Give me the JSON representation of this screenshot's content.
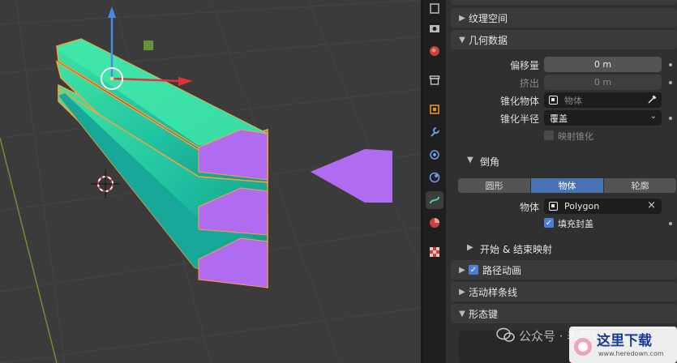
{
  "viewport": {
    "label": "3D Viewport"
  },
  "tabs": [
    {
      "name": "tab-render",
      "icon": "render-icon"
    },
    {
      "name": "tab-output",
      "icon": "output-icon"
    },
    {
      "name": "tab-world",
      "icon": "world-icon"
    },
    {
      "name": "tab-collection",
      "icon": "collection-icon"
    },
    {
      "name": "tab-object",
      "icon": "object-icon"
    },
    {
      "name": "tab-modifiers",
      "icon": "wrench-icon"
    },
    {
      "name": "tab-particles",
      "icon": "particles-icon"
    },
    {
      "name": "tab-physics",
      "icon": "physics-icon"
    },
    {
      "name": "tab-curve-data",
      "icon": "curve-icon",
      "active": true
    },
    {
      "name": "tab-material",
      "icon": "material-icon"
    },
    {
      "name": "tab-texture",
      "icon": "texture-icon"
    }
  ],
  "panel": {
    "texture_space": "纹理空间",
    "geometry": {
      "title": "几何数据",
      "offset_label": "偏移量",
      "offset_value": "0 m",
      "extrude_label": "挤出",
      "extrude_value": "0 m",
      "taper_object_label": "锥化物体",
      "taper_object_placeholder": "物体",
      "taper_radius_label": "锥化半径",
      "taper_radius_value": "覆盖",
      "map_taper_label": "映射锥化"
    },
    "bevel": {
      "title": "倒角",
      "modes": [
        "圆形",
        "物体",
        "轮廓"
      ],
      "active_mode": "物体",
      "object_label": "物体",
      "object_value": "Polygon",
      "fill_caps_label": "填充封盖",
      "fill_caps_checked": true
    },
    "start_end_mapping": "开始 & 结束映射",
    "path_animation": {
      "title": "路径动画",
      "checked": true
    },
    "active_spline": "活动样条线",
    "shape_keys": "形态键"
  },
  "watermark": {
    "text": "公众号 · 表要认",
    "logo_text": "这里下载",
    "url": "www.heredown.com"
  },
  "colors": {
    "accent": "#4772b3",
    "mesh_light": "#4ee6a8",
    "mesh_dark": "#0f7a6e",
    "profile": "#b06cf0",
    "selection": "#ffaa40"
  }
}
